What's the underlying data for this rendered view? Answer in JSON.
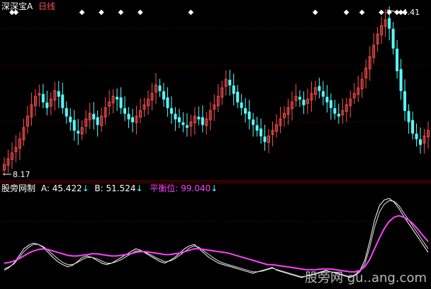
{
  "header": {
    "app_name": "深深宝A",
    "period": "日线"
  },
  "indicator": {
    "name": "股旁网制",
    "a_label": "A:",
    "a_value": "45.422",
    "a_arrow": "↓",
    "b_label": "B:",
    "b_value": "51.524",
    "b_arrow": "↓",
    "balance_label": "平衡位:",
    "balance_value": "99.040",
    "balance_arrow": "↓"
  },
  "price": {
    "high_label": "4.41",
    "low_label": "8.17"
  },
  "watermark": {
    "text": "股旁网 gu..ang.com"
  },
  "colors": {
    "up": "#ff5050",
    "down": "#54ffff",
    "line_white": "#ffffff",
    "line_magenta": "#ff40ff",
    "grid": "#800000"
  },
  "chart_data": [
    {
      "type": "candlestick",
      "closes": [
        7.9,
        8.1,
        8.3,
        8.5,
        8.8,
        9.2,
        9.6,
        10.0,
        10.3,
        10.4,
        10.1,
        9.9,
        10.2,
        10.5,
        10.3,
        9.9,
        9.6,
        9.4,
        9.1,
        9.0,
        9.2,
        9.5,
        9.7,
        9.5,
        9.3,
        9.6,
        9.9,
        10.1,
        10.3,
        10.2,
        9.9,
        9.7,
        9.5,
        9.4,
        9.6,
        9.8,
        10.0,
        10.2,
        10.4,
        10.7,
        10.5,
        10.2,
        9.9,
        9.7,
        9.5,
        9.4,
        9.3,
        9.2,
        9.4,
        9.6,
        9.5,
        9.3,
        9.5,
        9.8,
        10.0,
        10.3,
        10.6,
        10.9,
        10.7,
        10.4,
        10.1,
        9.9,
        9.7,
        9.5,
        9.3,
        9.1,
        8.9,
        8.7,
        8.9,
        9.1,
        9.3,
        9.5,
        9.7,
        9.9,
        10.1,
        10.3,
        10.2,
        10.0,
        10.2,
        10.4,
        10.6,
        10.5,
        10.3,
        10.1,
        9.9,
        9.7,
        9.6,
        9.8,
        10.0,
        10.2,
        10.4,
        10.6,
        10.9,
        11.3,
        11.7,
        12.1,
        12.5,
        12.8,
        13.0,
        12.7,
        12.0,
        11.2,
        10.5,
        9.8,
        9.4,
        9.0,
        8.8,
        8.6,
        8.9,
        9.1
      ],
      "high_marker": 4.41,
      "low_marker": 8.17,
      "signal_indices": [
        2,
        3,
        20,
        25,
        30,
        35,
        48,
        80,
        88,
        92,
        97,
        99,
        101,
        102,
        103
      ]
    },
    {
      "type": "line",
      "series": [
        {
          "name": "A",
          "values": [
            20,
            24,
            30,
            40,
            50,
            55,
            58,
            56,
            52,
            45,
            38,
            32,
            28,
            25,
            27,
            32,
            38,
            40,
            38,
            34,
            30,
            28,
            30,
            34,
            38,
            42,
            46,
            50,
            48,
            44,
            40,
            36,
            32,
            30,
            34,
            38,
            44,
            50,
            54,
            56,
            50,
            44,
            38,
            34,
            30,
            28,
            26,
            24,
            22,
            20,
            18,
            16,
            18,
            20,
            22,
            24,
            20,
            18,
            16,
            14,
            12,
            10,
            12,
            14,
            16,
            18,
            20,
            18,
            16,
            14,
            12,
            10,
            14,
            20,
            34,
            60,
            90,
            110,
            118,
            120,
            115,
            106,
            95,
            85,
            75,
            65,
            55,
            45
          ]
        },
        {
          "name": "B",
          "values": [
            22,
            25,
            29,
            37,
            46,
            52,
            56,
            56,
            53,
            48,
            42,
            36,
            31,
            28,
            28,
            31,
            35,
            38,
            38,
            36,
            33,
            30,
            30,
            32,
            35,
            39,
            43,
            47,
            47,
            45,
            42,
            38,
            35,
            32,
            33,
            36,
            41,
            46,
            51,
            54,
            52,
            47,
            42,
            37,
            33,
            30,
            28,
            26,
            24,
            22,
            20,
            18,
            18,
            19,
            21,
            23,
            21,
            19,
            17,
            15,
            13,
            11,
            12,
            13,
            15,
            17,
            19,
            18,
            17,
            15,
            13,
            11,
            13,
            18,
            29,
            52,
            80,
            101,
            112,
            117,
            116,
            110,
            100,
            90,
            80,
            70,
            60,
            50
          ]
        },
        {
          "name": "平衡位",
          "values": [
            30,
            31,
            33,
            36,
            40,
            44,
            47,
            49,
            50,
            49,
            47,
            45,
            43,
            41,
            40,
            40,
            41,
            42,
            43,
            43,
            42,
            41,
            40,
            40,
            41,
            42,
            43,
            45,
            46,
            46,
            45,
            44,
            43,
            42,
            42,
            43,
            44,
            46,
            48,
            50,
            50,
            49,
            48,
            47,
            46,
            45,
            44,
            42,
            40,
            38,
            36,
            34,
            32,
            30,
            28,
            28,
            27,
            26,
            25,
            24,
            23,
            22,
            21,
            21,
            21,
            22,
            22,
            22,
            21,
            20,
            19,
            18,
            18,
            20,
            25,
            35,
            50,
            65,
            78,
            88,
            94,
            96,
            94,
            90,
            84,
            76,
            68,
            60
          ]
        }
      ]
    }
  ]
}
